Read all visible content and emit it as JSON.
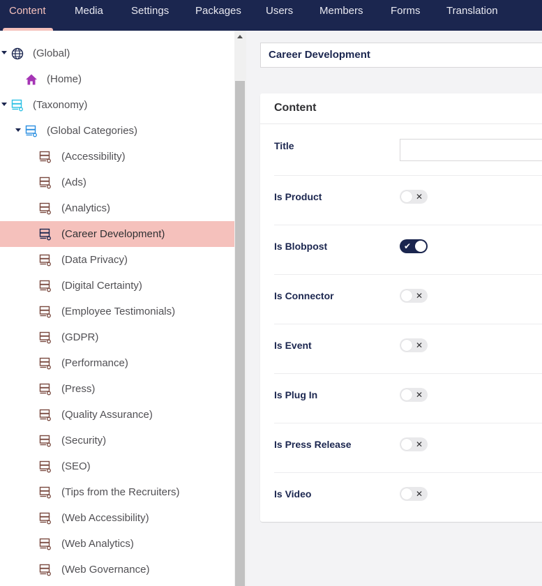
{
  "nav": {
    "tabs": [
      {
        "label": "Content",
        "active": true
      },
      {
        "label": "Media"
      },
      {
        "label": "Settings"
      },
      {
        "label": "Packages"
      },
      {
        "label": "Users"
      },
      {
        "label": "Members"
      },
      {
        "label": "Forms"
      },
      {
        "label": "Translation"
      }
    ]
  },
  "tree": {
    "items": [
      {
        "label": "(Global)",
        "icon": "globe-icon",
        "expanded": true
      },
      {
        "label": "(Home)",
        "icon": "home-icon"
      },
      {
        "label": "(Taxonomy)",
        "icon": "taxonomy-icon",
        "expanded": true
      },
      {
        "label": "(Global Categories)",
        "icon": "category-folder-icon",
        "expanded": true
      },
      {
        "label": "(Accessibility)",
        "icon": "category-icon"
      },
      {
        "label": "(Ads)",
        "icon": "category-icon"
      },
      {
        "label": "(Analytics)",
        "icon": "category-icon"
      },
      {
        "label": "(Career Development)",
        "icon": "category-icon",
        "selected": true
      },
      {
        "label": "(Data Privacy)",
        "icon": "category-icon"
      },
      {
        "label": "(Digital Certainty)",
        "icon": "category-icon"
      },
      {
        "label": "(Employee Testimonials)",
        "icon": "category-icon"
      },
      {
        "label": "(GDPR)",
        "icon": "category-icon"
      },
      {
        "label": "(Performance)",
        "icon": "category-icon"
      },
      {
        "label": "(Press)",
        "icon": "category-icon"
      },
      {
        "label": "(Quality Assurance)",
        "icon": "category-icon"
      },
      {
        "label": "(Security)",
        "icon": "category-icon"
      },
      {
        "label": "(SEO)",
        "icon": "category-icon"
      },
      {
        "label": "(Tips from the Recruiters)",
        "icon": "category-icon"
      },
      {
        "label": "(Web Accessibility)",
        "icon": "category-icon"
      },
      {
        "label": "(Web Analytics)",
        "icon": "category-icon"
      },
      {
        "label": "(Web Governance)",
        "icon": "category-icon"
      }
    ]
  },
  "editor": {
    "node_name": "Career Development",
    "group_title": "Content",
    "title_label": "Title",
    "title_value": "",
    "toggles": [
      {
        "label": "Is Product",
        "on": false
      },
      {
        "label": "Is Blobpost",
        "on": true
      },
      {
        "label": "Is Connector",
        "on": false
      },
      {
        "label": "Is Event",
        "on": false
      },
      {
        "label": "Is Plug In",
        "on": false
      },
      {
        "label": "Is Press Release",
        "on": false
      },
      {
        "label": "Is Video",
        "on": false
      }
    ]
  },
  "colors": {
    "nav_bg": "#1b264f",
    "active_tab": "#f5c1bc",
    "selected_row": "#f5c1bc",
    "globe_icon": "#1b264f",
    "home_icon": "#a535b5",
    "taxonomy_icon": "#2bc0e4",
    "category_icon": "#7a4a40"
  }
}
